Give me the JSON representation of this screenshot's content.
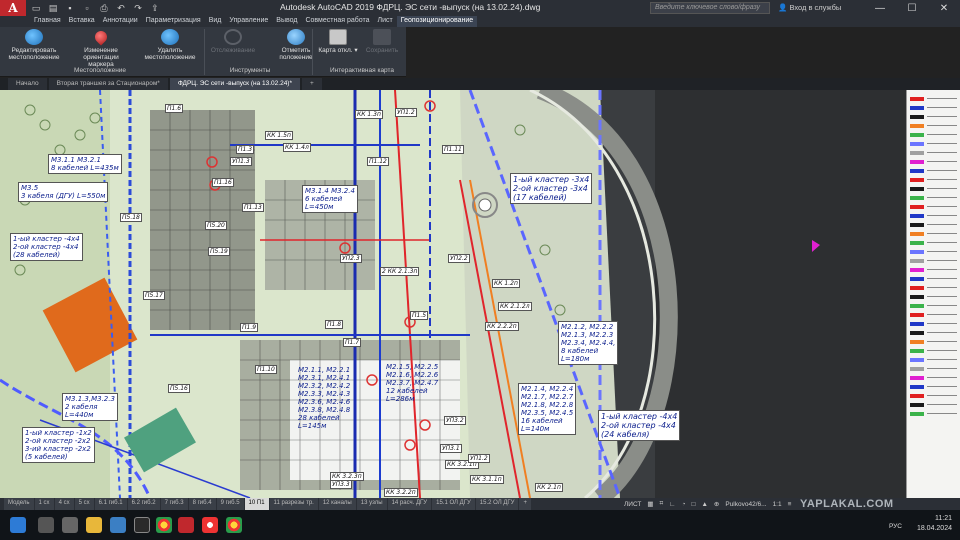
{
  "window": {
    "app_logo": "A",
    "title": "Autodesk AutoCAD 2019    ФДРЦ. ЭС сети -выпуск (на 13.02.24).dwg",
    "search_placeholder": "Введите ключевое слово/фразу",
    "signin_label": "Вход в службы",
    "minimize": "—",
    "maximize": "☐",
    "close": "✕"
  },
  "ribbon_tabs": [
    "Главная",
    "Вставка",
    "Аннотации",
    "Параметризация",
    "Вид",
    "Управление",
    "Вывод",
    "Совместная работа",
    "Лист",
    "Геопозиционирование"
  ],
  "active_ribbon_tab": "Геопозиционирование",
  "ribbon": {
    "buttons": [
      {
        "label1": "Редактировать",
        "label2": "местоположение",
        "enabled": true
      },
      {
        "label1": "Изменение ориентации",
        "label2": "маркера",
        "enabled": true
      },
      {
        "label1": "Удалить",
        "label2": "местоположение",
        "enabled": true
      },
      {
        "label1": "Отслеживание",
        "label2": "",
        "enabled": false
      },
      {
        "label1": "Отметить",
        "label2": "положение",
        "enabled": true
      },
      {
        "label1": "Карта откл.",
        "label2": "",
        "enabled": true
      },
      {
        "label1": "Сохранить",
        "label2": "",
        "enabled": false
      }
    ],
    "panels": [
      "Местоположение",
      "Инструменты",
      "Интерактивная карта"
    ]
  },
  "file_tabs": [
    "Начало",
    "Вторая траншея за Стационаром*",
    "ФДРЦ. ЭС сети -выпуск (на 13.02.24)*"
  ],
  "active_file_tab": 2,
  "drawing_labels": [
    {
      "lines": [
        "М3.1.1  М3.2.1",
        "8 кабелей  L=435м"
      ],
      "color": "blue"
    },
    {
      "lines": [
        "М3.5",
        "3 кабеля (ДГУ) L=550м"
      ],
      "color": "blue"
    },
    {
      "lines": [
        "1-ый кластер -4х4",
        "2-ой кластер -4х4",
        "(28 кабелей)"
      ],
      "color": "blue"
    },
    {
      "lines": [
        "М3.1.4  М3.2.4",
        "6 кабелей",
        "L=450м"
      ],
      "color": "blue"
    },
    {
      "lines": [
        "1-ый кластер -3х4",
        "2-ой кластер -3х4",
        "(17 кабелей)"
      ],
      "color": "blue"
    },
    {
      "lines": [
        "М2.1.2,  М2.2.2",
        "М2.1.3,  М2.2.3",
        "М2.3.4,  М2.4.4,",
        "8 кабелей",
        "L=180м"
      ],
      "color": "blue"
    },
    {
      "lines": [
        "М2.1.1,  М2.2.1",
        "М2.3.1,  М2.4.1",
        "М2.3.2,  М2.4.2",
        "М2.3.3,  М2.4.3",
        "М2.3.6,  М2.4.6",
        "М2.3.8,  М2.4.8",
        "28 кабелей",
        "L=145м"
      ],
      "color": "blue"
    },
    {
      "lines": [
        "М2.1.5,  М2.2.5",
        "М2.1.6,  М2.2.6",
        "М2.3.7,  М2.4.7",
        "12 кабелей",
        "L=286м"
      ],
      "color": "blue"
    },
    {
      "lines": [
        "М2.1.4,  М2.2.4",
        "М2.1.7,  М2.2.7",
        "М2.1.8,  М2.2.8",
        "М2.3.5,  М2.4.5",
        "16 кабелей",
        "L=140м"
      ],
      "color": "blue"
    },
    {
      "lines": [
        "1-ый кластер -4х4",
        "2-ой кластер -4х4",
        "(24 кабеля)"
      ],
      "color": "blue"
    },
    {
      "lines": [
        "М3.1.3,М3.2.3",
        "2 кабеля",
        "L=440м"
      ],
      "color": "blue"
    },
    {
      "lines": [
        "1-ый кластер -1х2",
        "2-ой кластер -2х2",
        "3-ий кластер -2х2",
        "(5 кабелей)"
      ],
      "color": "blue"
    }
  ],
  "small_labels": [
    "П1.6",
    "КК 1.5п",
    "КК 1.4л",
    "КК 1.3п",
    "УП1.2",
    "П1.12",
    "П1.11",
    "П1.3",
    "УП1.3",
    "П1.16",
    "П1.13",
    "П5.18",
    "П5.20",
    "П5.19",
    "П5.17",
    "УП2.3",
    "УП2.2",
    "2 КК 2.1.3п",
    "КК 1.2п",
    "КК 2.1.2л",
    "КК 2.2.2п",
    "П1.9",
    "П1.8",
    "П1.7",
    "П1.10",
    "П5.16",
    "УП3.2",
    "УП3.1",
    "КК 3.2.1п",
    "КК 3.2.2п",
    "КК 3.1.1п",
    "УП3.3",
    "КК 2.1п",
    "УП1.2",
    "КК 3.2.3п",
    "П1.5"
  ],
  "layout_tabs": [
    "Модель",
    "1 сх",
    "4 сх",
    "5 сх",
    "6.1 гиб.1",
    "6.2 гиб.2",
    "7 гиб.3",
    "8 гиб.4",
    "9 гиб.5",
    "10 П1",
    "11 разрезы тр.",
    "12 каналы",
    "13 узлы",
    "14 расч. ДГУ",
    "15.1 ОЛ ДГУ",
    "15.2 ОЛ ДГУ",
    "+"
  ],
  "active_layout_tab": "10 П1",
  "status": {
    "mode": "ЛИСТ",
    "coords_label": "Pulkovo42/6...",
    "zoom": "1:1"
  },
  "taskbar": {
    "lang": "РУС",
    "time": "11:21",
    "date": "18.04.2024"
  },
  "watermark": "YAPLAKAL.COM",
  "colors": {
    "accent": "#c0282d",
    "drawing_bg": "#dbe6cc",
    "label_blue": "#0b1e8c"
  }
}
